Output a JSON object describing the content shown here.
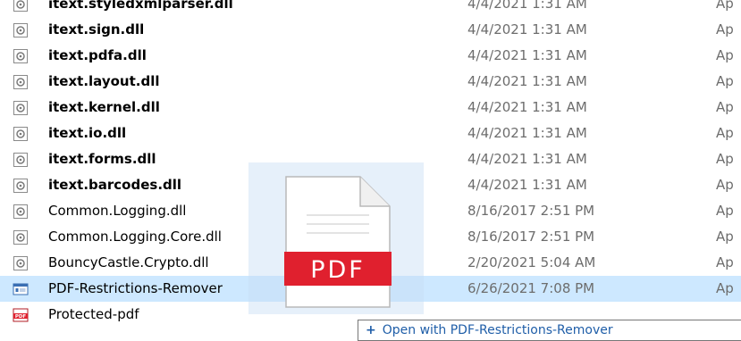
{
  "files": [
    {
      "name": "itext.styledxmlparser.dll",
      "date": "4/4/2021 1:31 AM",
      "type": "Ap",
      "icon": "dll-icon"
    },
    {
      "name": "itext.sign.dll",
      "date": "4/4/2021 1:31 AM",
      "type": "Ap",
      "icon": "dll-icon"
    },
    {
      "name": "itext.pdfa.dll",
      "date": "4/4/2021 1:31 AM",
      "type": "Ap",
      "icon": "dll-icon"
    },
    {
      "name": "itext.layout.dll",
      "date": "4/4/2021 1:31 AM",
      "type": "Ap",
      "icon": "dll-icon"
    },
    {
      "name": "itext.kernel.dll",
      "date": "4/4/2021 1:31 AM",
      "type": "Ap",
      "icon": "dll-icon"
    },
    {
      "name": "itext.io.dll",
      "date": "4/4/2021 1:31 AM",
      "type": "Ap",
      "icon": "dll-icon"
    },
    {
      "name": "itext.forms.dll",
      "date": "4/4/2021 1:31 AM",
      "type": "Ap",
      "icon": "dll-icon"
    },
    {
      "name": "itext.barcodes.dll",
      "date": "4/4/2021 1:31 AM",
      "type": "Ap",
      "icon": "dll-icon"
    },
    {
      "name": "Common.Logging.dll",
      "date": "8/16/2017 2:51 PM",
      "type": "Ap",
      "icon": "dll-icon"
    },
    {
      "name": "Common.Logging.Core.dll",
      "date": "8/16/2017 2:51 PM",
      "type": "Ap",
      "icon": "dll-icon"
    },
    {
      "name": "BouncyCastle.Crypto.dll",
      "date": "2/20/2021 5:04 AM",
      "type": "Ap",
      "icon": "dll-icon"
    },
    {
      "name": "PDF-Restrictions-Remover",
      "date": "6/26/2021 7:08 PM",
      "type": "Ap",
      "icon": "application-icon"
    },
    {
      "name": "Protected-pdf",
      "date": "",
      "type": "",
      "icon": "pdf-file-icon"
    }
  ],
  "drag_ghost": {
    "label": "PDF",
    "icon": "pdf-document-icon"
  },
  "tooltip": {
    "icon": "plus-icon",
    "text": "Open with PDF-Restrictions-Remover"
  },
  "colors": {
    "selection": "#cde8ff",
    "pdf_red": "#e0202e",
    "link_blue": "#1f5ea8"
  }
}
